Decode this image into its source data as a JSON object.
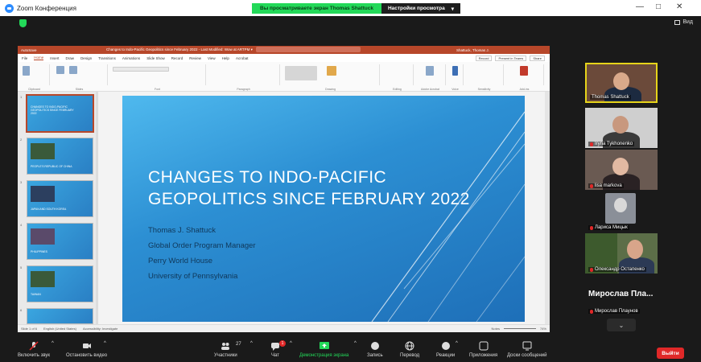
{
  "app": {
    "title": "Zoom Конференция"
  },
  "share_banner": {
    "status": "Вы просматриваете экран Thomas Shattuck",
    "options": "Настройки просмотра",
    "options_caret": "▾"
  },
  "window_controls": {
    "minimize": "—",
    "maximize": "□",
    "close": "✕"
  },
  "view_button": {
    "label": "Вид"
  },
  "ppt": {
    "autosave": "AutoSave",
    "doc_title": "Changes to Indo-Pacific Geopolitics since February 2022 - Last Modified: Wow at ARTPM ▾",
    "search": "Search",
    "user": "Shattuck, Thomas J.",
    "menu": [
      "File",
      "Home",
      "Insert",
      "Draw",
      "Design",
      "Transitions",
      "Animations",
      "Slide Show",
      "Record",
      "Review",
      "View",
      "Help",
      "Acrobat"
    ],
    "menu_right": [
      "Record",
      "Present in Teams",
      "Share"
    ],
    "ribbon_groups": [
      "Clipboard",
      "Slides",
      "Font",
      "Paragraph",
      "Drawing",
      "Editing",
      "Adobe Acrobat",
      "Voice",
      "Sensitivity",
      "Add-ins"
    ],
    "thumbs": [
      {
        "num": "1",
        "text": "CHANGES TO INDO-PACIFIC GEOPOLITICS SINCE FEBRUARY 2022"
      },
      {
        "num": "2",
        "text": "PEOPLE'S REPUBLIC OF CHINA"
      },
      {
        "num": "3",
        "text": "JAPAN AND SOUTH KOREA"
      },
      {
        "num": "4",
        "text": "PHILIPPINES"
      },
      {
        "num": "5",
        "text": "TAIWAN"
      },
      {
        "num": "6",
        "text": ""
      }
    ],
    "slide": {
      "headline_1": "CHANGES TO INDO-PACIFIC",
      "headline_2": "GEOPOLITICS SINCE FEBRUARY 2022",
      "sub": [
        "Thomas J. Shattuck",
        "Global Order Program Manager",
        "Perry World House",
        "University of Pennsylvania"
      ]
    },
    "status": {
      "slide": "Slide 1 of 6",
      "lang": "English (United States)",
      "access": "Accessibility: Investigate",
      "notes": "Notes",
      "zoom": "74%"
    }
  },
  "participants": [
    {
      "name": "Thomas Shattuck",
      "muted": false
    },
    {
      "name": "Iryna Tykhonenko",
      "muted": true
    },
    {
      "name": "lisa markova",
      "muted": true
    },
    {
      "name": "Лариса Мицык",
      "muted": true
    },
    {
      "name": "Олександр Остапенко",
      "muted": true
    },
    {
      "name": "Мирослав Плаунов",
      "display": "Мирослав Пла...",
      "muted": true
    }
  ],
  "more_participants": "⌄",
  "controls": [
    {
      "label": "Включить звук"
    },
    {
      "label": "Остановить видео"
    },
    {
      "label": "Участники",
      "count": "27"
    },
    {
      "label": "Чат",
      "badge": "1"
    },
    {
      "label": "Демонстрация экрана"
    },
    {
      "label": "Запись"
    },
    {
      "label": "Перевод"
    },
    {
      "label": "Реакции"
    },
    {
      "label": "Приложения"
    },
    {
      "label": "Доски сообщений"
    }
  ],
  "leave": "Выйти",
  "colors": {
    "zoom_blue": "#2d8cff",
    "share_green": "#23d959",
    "leave_red": "#e02828",
    "ppt_red": "#b7472a",
    "speaker_yellow": "#e6d41a"
  }
}
